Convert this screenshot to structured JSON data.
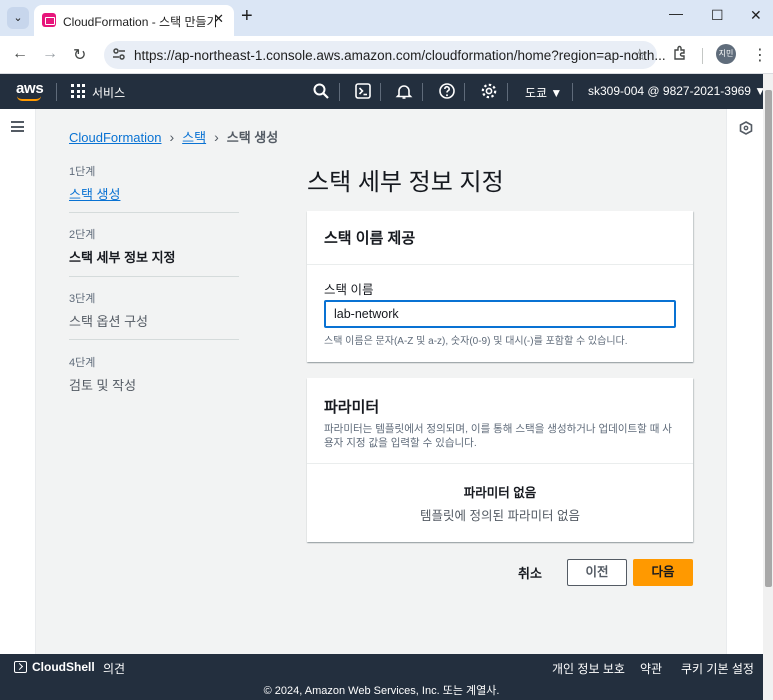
{
  "browser": {
    "tab_title": "CloudFormation - 스택 만들기",
    "tab_close": "✕",
    "new_tab": "+",
    "url": "https://ap-northeast-1.console.aws.amazon.com/cloudformation/home?region=ap-north...",
    "profile_initials": "지민",
    "tab_menu_icon": "chevron-down-icon"
  },
  "aws_nav": {
    "logo": "aws",
    "services": "서비스",
    "region": "도쿄 ▼",
    "account": "sk309-004 @ 9827-2021-3969 ▼",
    "accent": "#ff9900"
  },
  "breadcrumb": {
    "items": [
      "CloudFormation",
      "스택"
    ],
    "current": "스택 생성"
  },
  "steps": [
    {
      "num": "1단계",
      "label": "스택 생성",
      "state": "link"
    },
    {
      "num": "2단계",
      "label": "스택 세부 정보 지정",
      "state": "active"
    },
    {
      "num": "3단계",
      "label": "스택 옵션 구성",
      "state": "muted"
    },
    {
      "num": "4단계",
      "label": "검토 및 작성",
      "state": "muted"
    }
  ],
  "page_title": "스택 세부 정보 지정",
  "stack_name_panel": {
    "title": "스택 이름 제공",
    "field_label": "스택 이름",
    "value": "lab-network",
    "hint": "스택 이름은 문자(A-Z 및 a-z), 숫자(0-9) 및 대시(-)를 포함할 수 있습니다."
  },
  "params_panel": {
    "title": "파라미터",
    "description": "파라미터는 템플릿에서 정의되며, 이를 통해 스택을 생성하거나 업데이트할 때 사용자 지정 값을 입력할 수 있습니다.",
    "empty_title": "파라미터 없음",
    "empty_desc": "템플릿에 정의된 파라미터 없음"
  },
  "actions": {
    "cancel": "취소",
    "previous": "이전",
    "next": "다음"
  },
  "footer": {
    "cloudshell": "CloudShell",
    "feedback": "의견",
    "privacy": "개인 정보 보호",
    "terms": "약관",
    "cookies": "쿠키 기본 설정",
    "copyright": "© 2024, Amazon Web Services, Inc. 또는 계열사."
  }
}
